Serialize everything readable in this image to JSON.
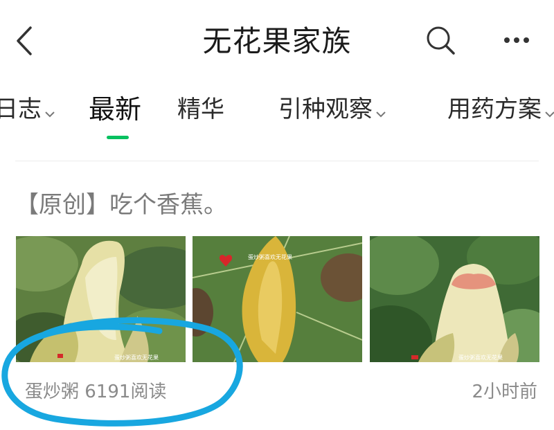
{
  "header": {
    "title": "无花果家族",
    "icons": {
      "back": "chevron-left-icon",
      "search": "search-icon",
      "more": "more-horizontal-icon"
    }
  },
  "tabs": [
    {
      "label": "日志",
      "has_dropdown": true,
      "active": false
    },
    {
      "label": "最新",
      "has_dropdown": false,
      "active": true
    },
    {
      "label": "精华",
      "has_dropdown": false,
      "active": false
    },
    {
      "label": "引种观察",
      "has_dropdown": true,
      "active": false
    },
    {
      "label": "用药方案",
      "has_dropdown": true,
      "active": false
    }
  ],
  "post": {
    "title": "【原创】吃个香蕉。",
    "author": "蛋炒粥",
    "read_count": "6191阅读",
    "time": "2小时前",
    "images": [
      {
        "watermark": "蛋炒粥喜欢无花果"
      },
      {
        "watermark": "蛋炒粥喜欢无花果"
      },
      {
        "watermark": "蛋炒粥喜欢无花果"
      }
    ]
  },
  "colors": {
    "accent": "#07c160",
    "annotation": "#18a7e0",
    "muted_text": "#8a8a8a"
  }
}
